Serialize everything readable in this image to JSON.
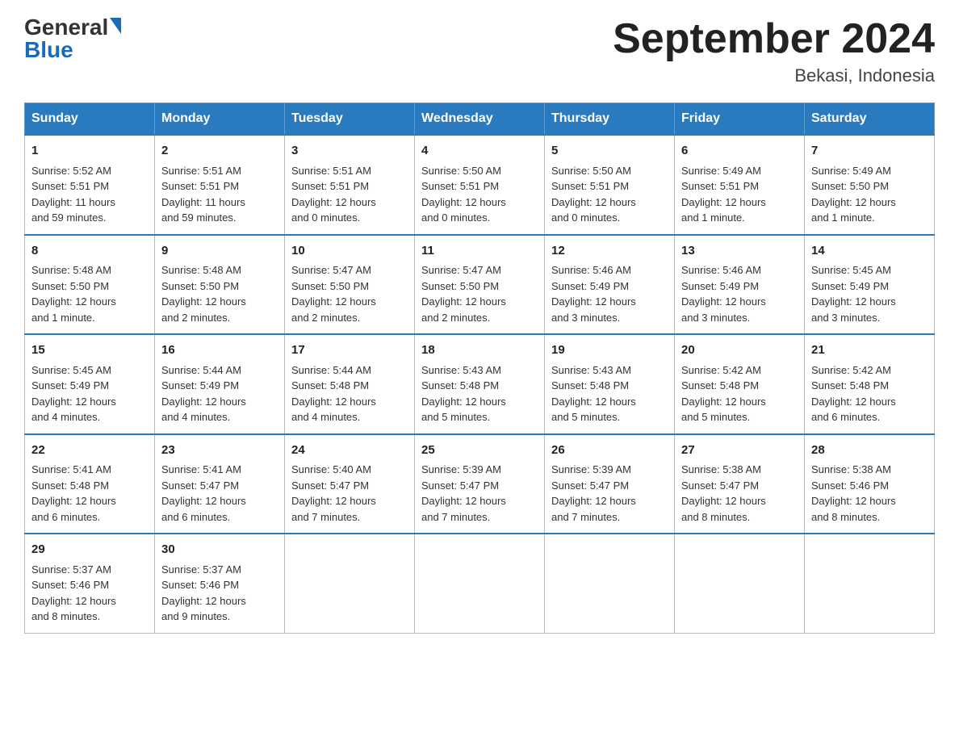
{
  "logo": {
    "general": "General",
    "blue": "Blue"
  },
  "header": {
    "month_year": "September 2024",
    "location": "Bekasi, Indonesia"
  },
  "days_of_week": [
    "Sunday",
    "Monday",
    "Tuesday",
    "Wednesday",
    "Thursday",
    "Friday",
    "Saturday"
  ],
  "weeks": [
    [
      {
        "day": "1",
        "sunrise": "5:52 AM",
        "sunset": "5:51 PM",
        "daylight": "11 hours and 59 minutes."
      },
      {
        "day": "2",
        "sunrise": "5:51 AM",
        "sunset": "5:51 PM",
        "daylight": "11 hours and 59 minutes."
      },
      {
        "day": "3",
        "sunrise": "5:51 AM",
        "sunset": "5:51 PM",
        "daylight": "12 hours and 0 minutes."
      },
      {
        "day": "4",
        "sunrise": "5:50 AM",
        "sunset": "5:51 PM",
        "daylight": "12 hours and 0 minutes."
      },
      {
        "day": "5",
        "sunrise": "5:50 AM",
        "sunset": "5:51 PM",
        "daylight": "12 hours and 0 minutes."
      },
      {
        "day": "6",
        "sunrise": "5:49 AM",
        "sunset": "5:51 PM",
        "daylight": "12 hours and 1 minute."
      },
      {
        "day": "7",
        "sunrise": "5:49 AM",
        "sunset": "5:50 PM",
        "daylight": "12 hours and 1 minute."
      }
    ],
    [
      {
        "day": "8",
        "sunrise": "5:48 AM",
        "sunset": "5:50 PM",
        "daylight": "12 hours and 1 minute."
      },
      {
        "day": "9",
        "sunrise": "5:48 AM",
        "sunset": "5:50 PM",
        "daylight": "12 hours and 2 minutes."
      },
      {
        "day": "10",
        "sunrise": "5:47 AM",
        "sunset": "5:50 PM",
        "daylight": "12 hours and 2 minutes."
      },
      {
        "day": "11",
        "sunrise": "5:47 AM",
        "sunset": "5:50 PM",
        "daylight": "12 hours and 2 minutes."
      },
      {
        "day": "12",
        "sunrise": "5:46 AM",
        "sunset": "5:49 PM",
        "daylight": "12 hours and 3 minutes."
      },
      {
        "day": "13",
        "sunrise": "5:46 AM",
        "sunset": "5:49 PM",
        "daylight": "12 hours and 3 minutes."
      },
      {
        "day": "14",
        "sunrise": "5:45 AM",
        "sunset": "5:49 PM",
        "daylight": "12 hours and 3 minutes."
      }
    ],
    [
      {
        "day": "15",
        "sunrise": "5:45 AM",
        "sunset": "5:49 PM",
        "daylight": "12 hours and 4 minutes."
      },
      {
        "day": "16",
        "sunrise": "5:44 AM",
        "sunset": "5:49 PM",
        "daylight": "12 hours and 4 minutes."
      },
      {
        "day": "17",
        "sunrise": "5:44 AM",
        "sunset": "5:48 PM",
        "daylight": "12 hours and 4 minutes."
      },
      {
        "day": "18",
        "sunrise": "5:43 AM",
        "sunset": "5:48 PM",
        "daylight": "12 hours and 5 minutes."
      },
      {
        "day": "19",
        "sunrise": "5:43 AM",
        "sunset": "5:48 PM",
        "daylight": "12 hours and 5 minutes."
      },
      {
        "day": "20",
        "sunrise": "5:42 AM",
        "sunset": "5:48 PM",
        "daylight": "12 hours and 5 minutes."
      },
      {
        "day": "21",
        "sunrise": "5:42 AM",
        "sunset": "5:48 PM",
        "daylight": "12 hours and 6 minutes."
      }
    ],
    [
      {
        "day": "22",
        "sunrise": "5:41 AM",
        "sunset": "5:48 PM",
        "daylight": "12 hours and 6 minutes."
      },
      {
        "day": "23",
        "sunrise": "5:41 AM",
        "sunset": "5:47 PM",
        "daylight": "12 hours and 6 minutes."
      },
      {
        "day": "24",
        "sunrise": "5:40 AM",
        "sunset": "5:47 PM",
        "daylight": "12 hours and 7 minutes."
      },
      {
        "day": "25",
        "sunrise": "5:39 AM",
        "sunset": "5:47 PM",
        "daylight": "12 hours and 7 minutes."
      },
      {
        "day": "26",
        "sunrise": "5:39 AM",
        "sunset": "5:47 PM",
        "daylight": "12 hours and 7 minutes."
      },
      {
        "day": "27",
        "sunrise": "5:38 AM",
        "sunset": "5:47 PM",
        "daylight": "12 hours and 8 minutes."
      },
      {
        "day": "28",
        "sunrise": "5:38 AM",
        "sunset": "5:46 PM",
        "daylight": "12 hours and 8 minutes."
      }
    ],
    [
      {
        "day": "29",
        "sunrise": "5:37 AM",
        "sunset": "5:46 PM",
        "daylight": "12 hours and 8 minutes."
      },
      {
        "day": "30",
        "sunrise": "5:37 AM",
        "sunset": "5:46 PM",
        "daylight": "12 hours and 9 minutes."
      },
      null,
      null,
      null,
      null,
      null
    ]
  ]
}
